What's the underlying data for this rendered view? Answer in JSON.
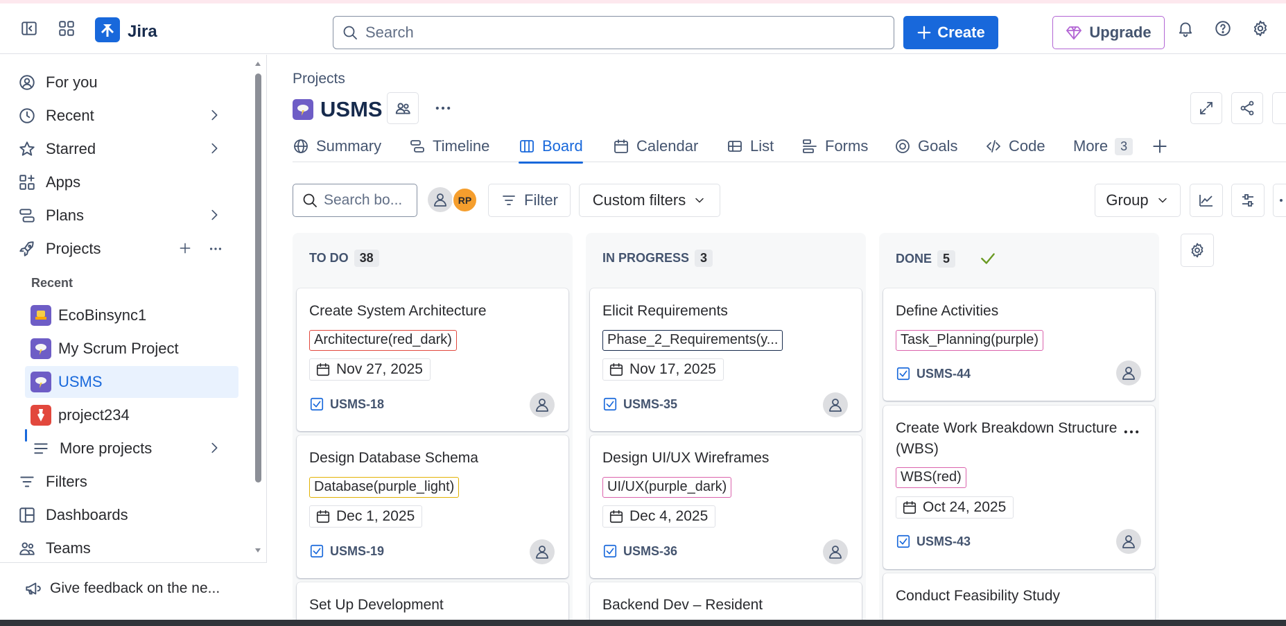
{
  "topbar": {
    "app_name": "Jira",
    "search_placeholder": "Search",
    "create_label": "Create",
    "upgrade_label": "Upgrade"
  },
  "sidebar": {
    "items": [
      {
        "label": "For you",
        "icon": "user-circle-icon"
      },
      {
        "label": "Recent",
        "icon": "clock-icon"
      },
      {
        "label": "Starred",
        "icon": "star-icon"
      },
      {
        "label": "Apps",
        "icon": "apps-icon"
      },
      {
        "label": "Plans",
        "icon": "plans-icon"
      },
      {
        "label": "Projects",
        "icon": "rocket-icon"
      }
    ],
    "recent_label": "Recent",
    "recent_projects": [
      {
        "label": "EcoBinsync1",
        "color": "#6e5dc6"
      },
      {
        "label": "My Scrum Project",
        "color": "#6e5dc6"
      },
      {
        "label": "USMS",
        "color": "#6e5dc6"
      },
      {
        "label": "project234",
        "color": "#e2483d"
      }
    ],
    "more_projects": "More projects",
    "bottom_items": [
      {
        "label": "Filters",
        "icon": "filter-icon"
      },
      {
        "label": "Dashboards",
        "icon": "dashboard-icon"
      },
      {
        "label": "Teams",
        "icon": "teams-icon"
      }
    ],
    "feedback": "Give feedback on the ne..."
  },
  "main": {
    "breadcrumb": "Projects",
    "project_name": "USMS",
    "tabs": [
      {
        "label": "Summary"
      },
      {
        "label": "Timeline"
      },
      {
        "label": "Board"
      },
      {
        "label": "Calendar"
      },
      {
        "label": "List"
      },
      {
        "label": "Forms"
      },
      {
        "label": "Goals"
      },
      {
        "label": "Code"
      },
      {
        "label": "More",
        "count": "3"
      }
    ],
    "board_search_placeholder": "Search bo...",
    "avatar_initials": "RP",
    "filter_label": "Filter",
    "custom_filters_label": "Custom filters",
    "group_label": "Group"
  },
  "board": {
    "columns": [
      {
        "name": "TO DO",
        "count": "38",
        "cards": [
          {
            "title": "Create System Architecture",
            "label": "Architecture(red_dark)",
            "label_color": "#e2483d",
            "date": "Nov 27, 2025",
            "key": "USMS-18"
          },
          {
            "title": "Design Database Schema",
            "label": "Database(purple_light)",
            "label_color": "#e2b203",
            "date": "Dec 1, 2025",
            "key": "USMS-19"
          },
          {
            "title": "Set Up Development"
          }
        ]
      },
      {
        "name": "IN PROGRESS",
        "count": "3",
        "cards": [
          {
            "title": "Elicit Requirements",
            "label": "Phase_2_Requirements(y...",
            "label_color": "#172b4d",
            "date": "Nov 17, 2025",
            "key": "USMS-35"
          },
          {
            "title": "Design UI/UX Wireframes",
            "label": "UI/UX(purple_dark)",
            "label_color": "#da62ac",
            "date": "Dec 4, 2025",
            "key": "USMS-36"
          },
          {
            "title": "Backend Dev – Resident"
          }
        ]
      },
      {
        "name": "DONE",
        "count": "5",
        "cards": [
          {
            "title": "Define Activities",
            "label": "Task_Planning(purple)",
            "label_color": "#da62ac",
            "key": "USMS-44"
          },
          {
            "title": "Create Work Breakdown Structure (WBS)",
            "label": "WBS(red)",
            "label_color": "#da62ac",
            "date": "Oct 24, 2025",
            "key": "USMS-43"
          },
          {
            "title": "Conduct Feasibility Study"
          }
        ]
      }
    ]
  },
  "colors": {
    "brand": "#1868db",
    "upgrade_border": "#b265d4",
    "avatar_rp": "#f59e2d",
    "done_check": "#6a9a23"
  }
}
